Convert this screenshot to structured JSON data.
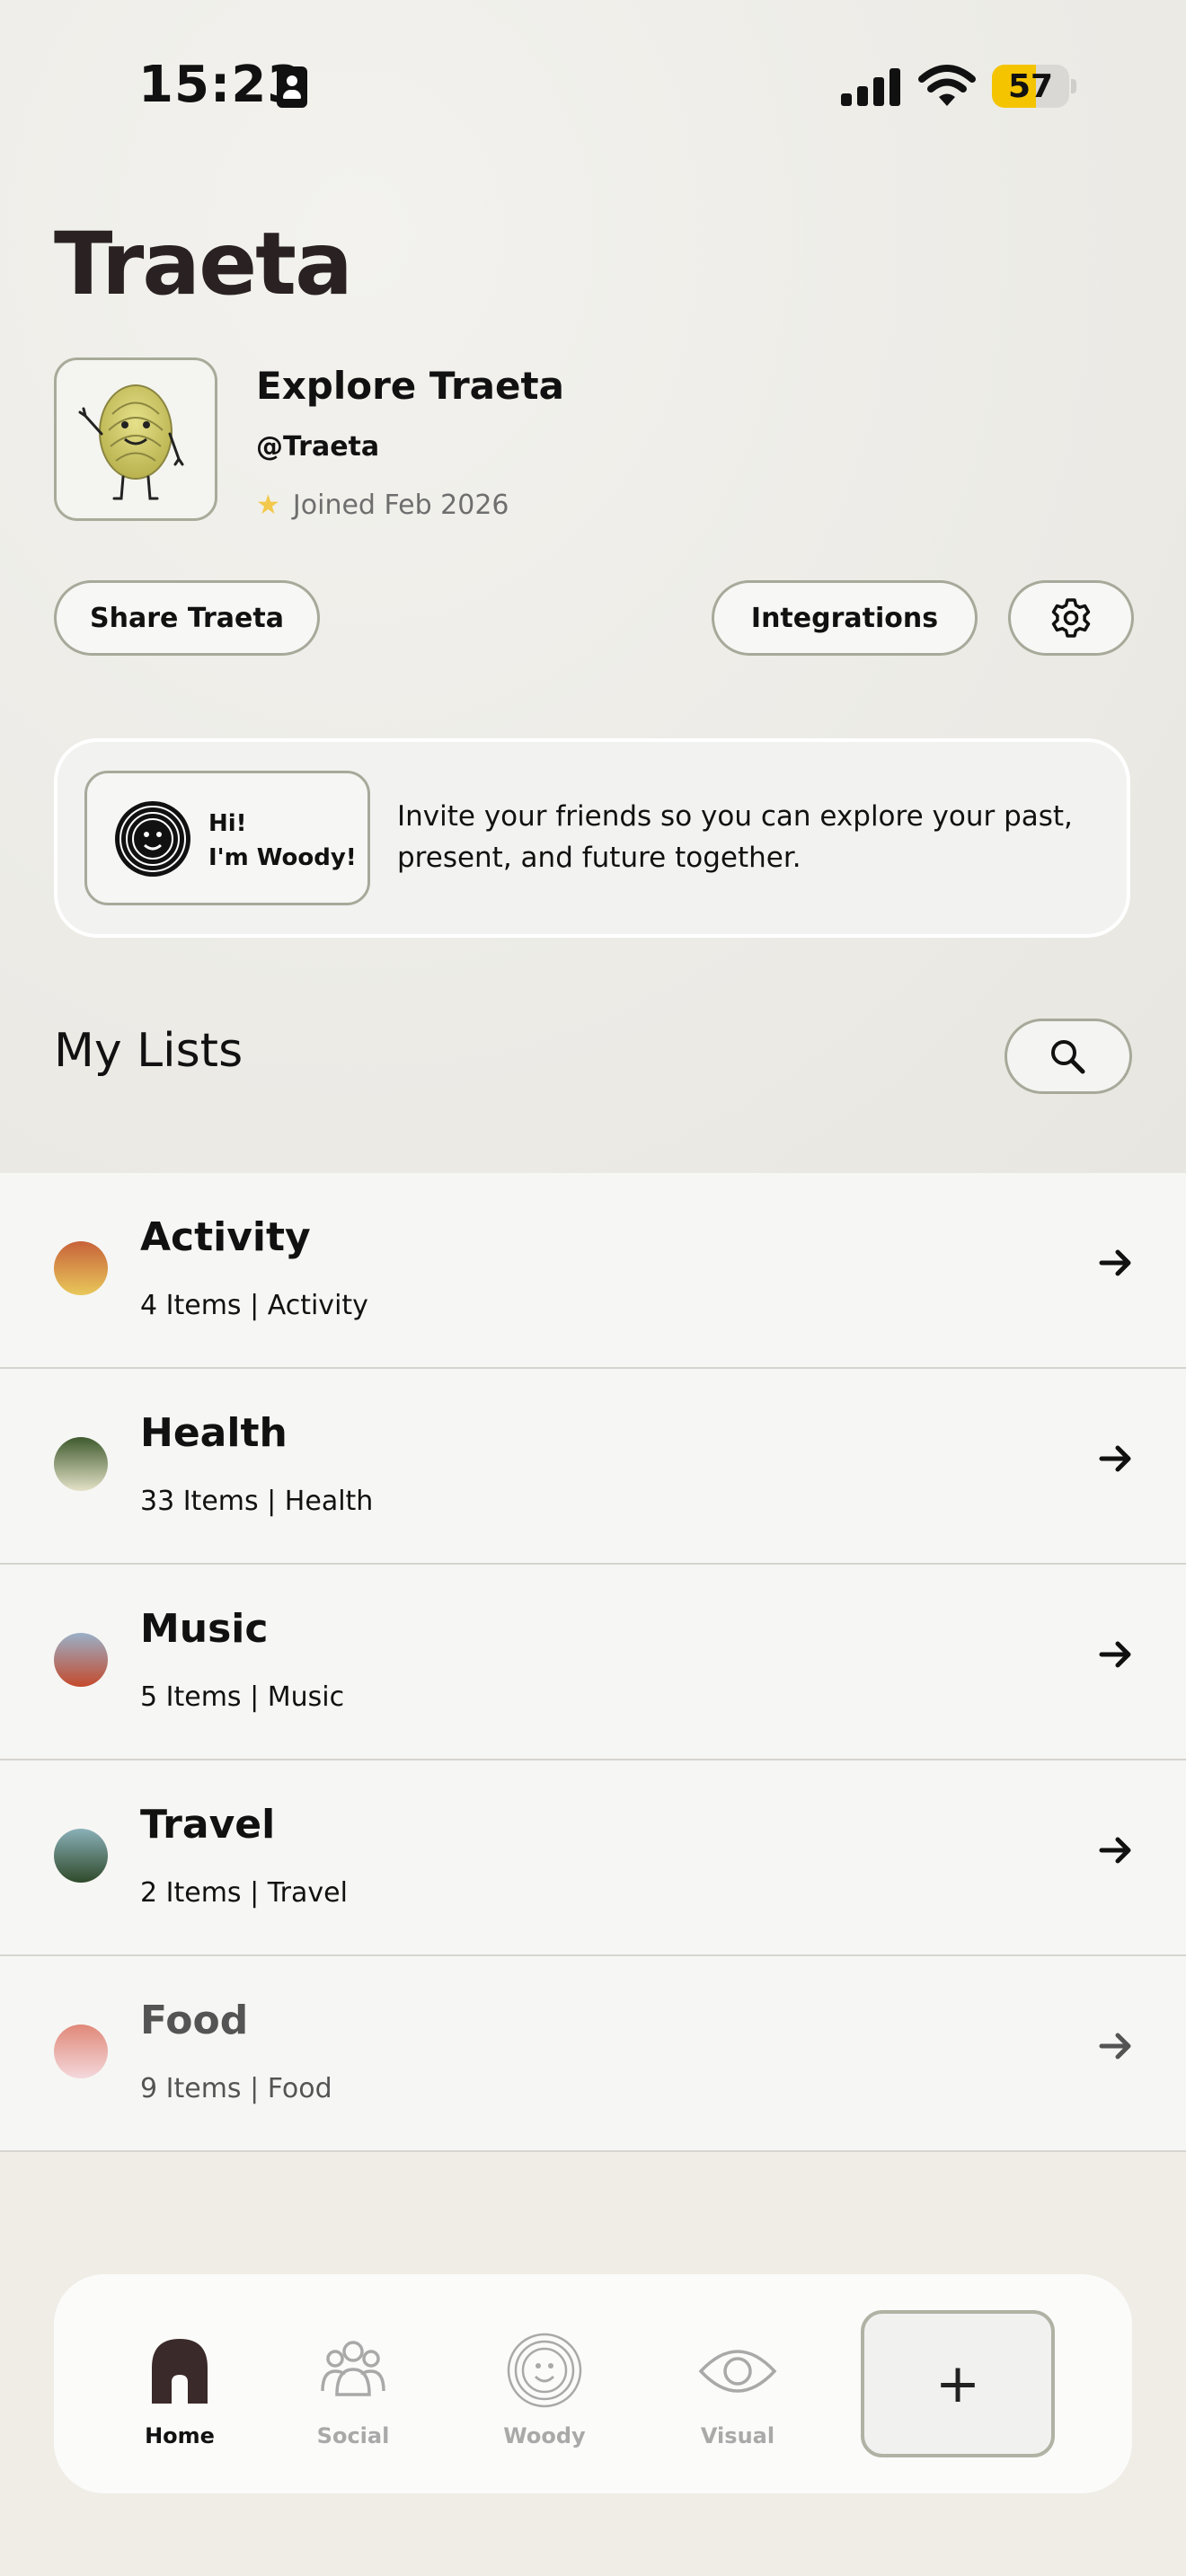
{
  "status_bar": {
    "time": "15:23",
    "battery_level": "57",
    "battery_fraction": 0.57
  },
  "app": {
    "logo": "Traeta"
  },
  "profile": {
    "name": "Explore Traeta",
    "handle": "@Traeta",
    "joined": "Joined Feb 2026"
  },
  "actions": {
    "share_label": "Share Traeta",
    "integrations_label": "Integrations",
    "settings_icon": "gear-icon"
  },
  "woody": {
    "greeting_line1": "Hi!",
    "greeting_line2": "I'm Woody!",
    "invite_text": "Invite your friends so you can explore your past, present, and future together."
  },
  "lists_section": {
    "title": "My Lists",
    "search_icon": "search-icon"
  },
  "lists": [
    {
      "title": "Activity",
      "subtitle": "4 Items | Activity",
      "color_top": "#c8623a",
      "color_bottom": "#e8c85a"
    },
    {
      "title": "Health",
      "subtitle": "33 Items | Health",
      "color_top": "#3f5a2e",
      "color_bottom": "#e4e2c8"
    },
    {
      "title": "Music",
      "subtitle": "5 Items | Music",
      "color_top": "#9ab0c8",
      "color_bottom": "#c44a2c"
    },
    {
      "title": "Travel",
      "subtitle": "2 Items | Travel",
      "color_top": "#8ab0b8",
      "color_bottom": "#2f4a2a"
    },
    {
      "title": "Food",
      "subtitle": "9 Items | Food",
      "color_top": "#e08878",
      "color_bottom": "#f4d8dc"
    }
  ],
  "tabbar": {
    "tabs": [
      {
        "label": "Home",
        "icon": "home-icon",
        "active": true
      },
      {
        "label": "Social",
        "icon": "people-icon",
        "active": false
      },
      {
        "label": "Woody",
        "icon": "woody-icon",
        "active": false
      },
      {
        "label": "Visual",
        "icon": "eye-icon",
        "active": false
      }
    ],
    "add_label": "+"
  },
  "colors": {
    "accent_border": "#a7a99a",
    "text": "#111111",
    "muted": "#6e6e6e"
  }
}
